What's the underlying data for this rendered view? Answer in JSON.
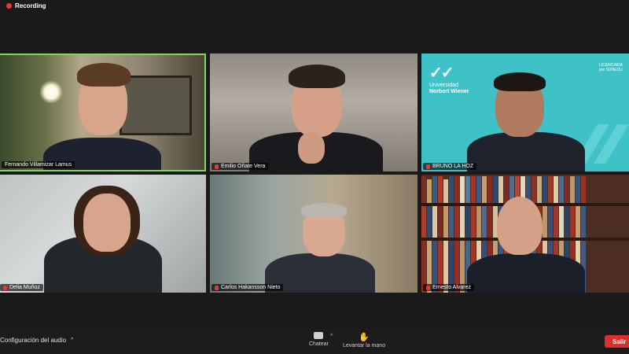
{
  "recording": {
    "label": "Recording"
  },
  "participants": [
    {
      "name": "Fernando Villamizar Lamus",
      "muted": false,
      "speaking": true
    },
    {
      "name": "Emilio Oñate Vera",
      "muted": true,
      "speaking": false
    },
    {
      "name": "BRUNO LA HOZ",
      "muted": true,
      "speaking": false
    },
    {
      "name": "Delia Muñoz",
      "muted": true,
      "speaking": false
    },
    {
      "name": "Carlos Hakansson Nieto",
      "muted": true,
      "speaking": false
    },
    {
      "name": "Ernesto Alvarez",
      "muted": true,
      "speaking": false
    }
  ],
  "background_logo": {
    "university": "Universidad",
    "university_name": "Norbert Wiener",
    "badge_line1": "LICENCIADA",
    "badge_line2": "por SUNEDU"
  },
  "toolbar": {
    "audio_settings": "Configuración del audio",
    "chat": "Chatear",
    "raise_hand": "Levantar la mano",
    "leave": "Salir"
  },
  "colors": {
    "active_speaker_border": "#7ed957",
    "leave_button": "#d9302c",
    "recording_dot": "#e53935",
    "brand_teal": "#3fc2c7"
  }
}
